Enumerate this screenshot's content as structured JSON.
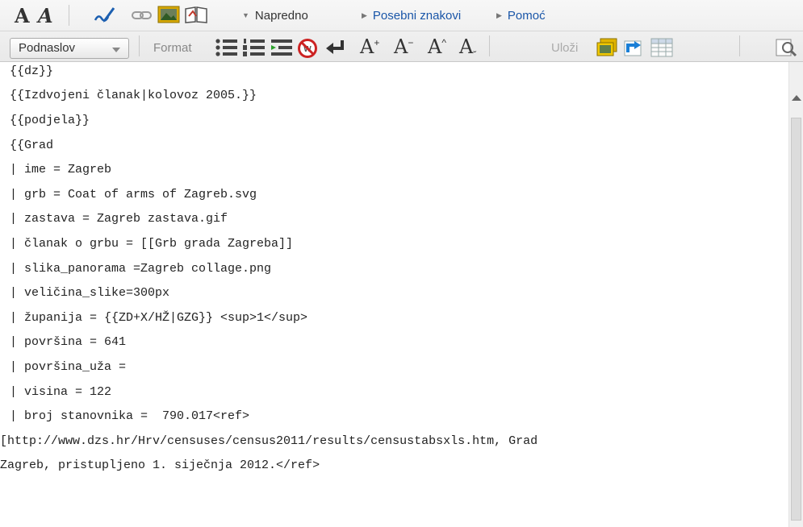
{
  "toolbar_primary": {
    "bold_label": "A",
    "italic_label": "A",
    "icons": [
      "signature-icon",
      "link-icon",
      "image-icon",
      "book-icon"
    ],
    "menus": [
      {
        "label": "Napredno",
        "color": "#333333"
      },
      {
        "label": "Posebni znakovi",
        "color": "#1a56a8"
      },
      {
        "label": "Pomoć",
        "color": "#1a56a8"
      }
    ]
  },
  "toolbar_secondary": {
    "heading_select": "Podnaslov",
    "format_label": "Format",
    "format_icons": [
      "bulleted-list-icon",
      "numbered-list-icon",
      "indent-list-icon",
      "nowiki-icon",
      "newline-icon"
    ],
    "font_buttons": [
      {
        "base": "A",
        "mark": "+"
      },
      {
        "base": "A",
        "mark": "−"
      },
      {
        "base": "A",
        "mark": "^"
      },
      {
        "base": "A",
        "mark": "ˇ"
      }
    ],
    "insert_label": "Uloži",
    "insert_icons": [
      "gallery-icon",
      "redirect-icon",
      "table-icon"
    ],
    "right_icon": "search-replace-icon"
  },
  "editor": {
    "lines": [
      "{{dz}}",
      "{{Izdvojeni članak|kolovoz 2005.}}",
      "{{podjela}}",
      "{{Grad",
      "| ime = Zagreb",
      "| grb = Coat of arms of Zagreb.svg",
      "| zastava = Zagreb zastava.gif",
      "| članak o grbu = [[Grb grada Zagreba]]",
      "| slika_panorama =Zagreb collage.png",
      "| veličina_slike=300px",
      "| županija = {{ZD+X/HŽ|GZG}} <sup>1</sup>",
      "| površina = 641",
      "| površina_uža =",
      "| visina = 122",
      "| broj stanovnika =  790.017<ref>",
      "[http://www.dzs.hr/Hrv/censuses/census2011/results/censustabsxls.htm, Grad",
      "Zagreb, pristupljeno 1. siječnja 2012.</ref>"
    ]
  }
}
